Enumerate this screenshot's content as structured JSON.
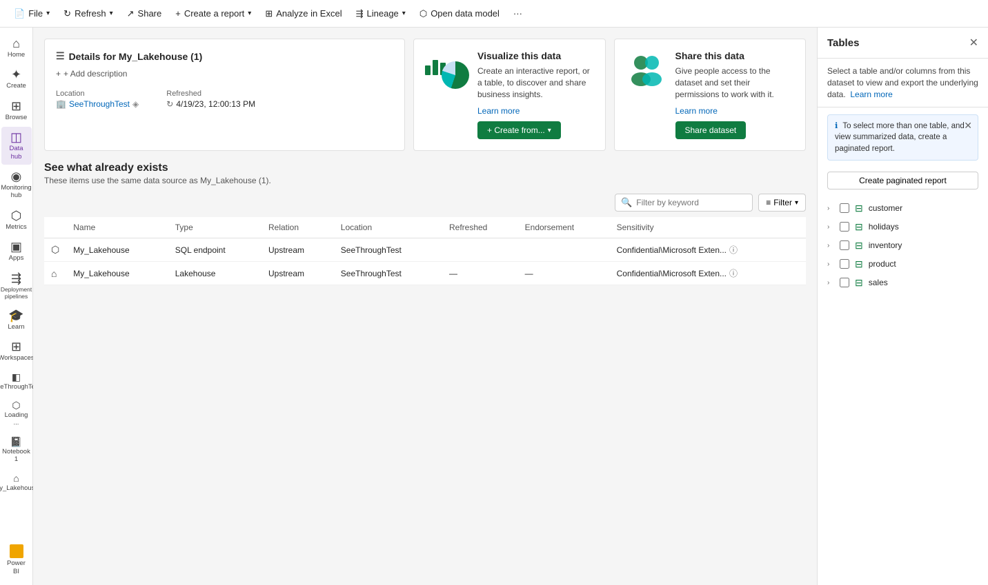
{
  "toolbar": {
    "file_label": "File",
    "refresh_label": "Refresh",
    "share_label": "Share",
    "create_report_label": "Create a report",
    "analyze_excel_label": "Analyze in Excel",
    "lineage_label": "Lineage",
    "open_data_model_label": "Open data model",
    "more_label": "···"
  },
  "sidebar": {
    "items": [
      {
        "id": "home",
        "label": "Home",
        "icon": "⌂"
      },
      {
        "id": "create",
        "label": "Create",
        "icon": "+"
      },
      {
        "id": "browse",
        "label": "Browse",
        "icon": "⊞"
      },
      {
        "id": "datahub",
        "label": "Data hub",
        "icon": "◫",
        "active": true
      },
      {
        "id": "monitoring",
        "label": "Monitoring hub",
        "icon": "◉"
      },
      {
        "id": "metrics",
        "label": "Metrics",
        "icon": "⬡"
      },
      {
        "id": "apps",
        "label": "Apps",
        "icon": "▣"
      },
      {
        "id": "deployment",
        "label": "Deployment pipelines",
        "icon": "⇶"
      },
      {
        "id": "learn",
        "label": "Learn",
        "icon": "📖"
      },
      {
        "id": "workspaces",
        "label": "Workspaces",
        "icon": "⊞"
      },
      {
        "id": "seethrough",
        "label": "SeeThroughTest",
        "icon": "◧"
      },
      {
        "id": "loading",
        "label": "Loading ...",
        "icon": "⬡"
      },
      {
        "id": "notebook",
        "label": "Notebook 1",
        "icon": "📓"
      },
      {
        "id": "mylakehouse",
        "label": "My_Lakehouse",
        "icon": "⌂"
      }
    ],
    "powerbi_label": "Power BI"
  },
  "details_card": {
    "title": "Details for My_Lakehouse (1)",
    "add_desc_label": "+ Add description",
    "location_label": "Location",
    "location_value": "SeeThroughTest",
    "refreshed_label": "Refreshed",
    "refreshed_value": "4/19/23, 12:00:13 PM"
  },
  "visualize_card": {
    "title": "Visualize this data",
    "description": "Create an interactive report, or a table, to discover and share business insights.",
    "learn_more": "Learn more",
    "create_btn": "+ Create from...",
    "create_dropdown": true
  },
  "share_card": {
    "title": "Share this data",
    "description": "Give people access to the dataset and set their permissions to work with it.",
    "learn_more": "Learn more",
    "share_btn": "Share dataset"
  },
  "section": {
    "title": "See what already exists",
    "subtitle": "These items use the same data source as My_Lakehouse (1).",
    "search_placeholder": "Filter by keyword",
    "filter_label": "Filter"
  },
  "table": {
    "columns": [
      "Name",
      "Type",
      "Relation",
      "Location",
      "Refreshed",
      "Endorsement",
      "Sensitivity"
    ],
    "rows": [
      {
        "icon": "sql",
        "name": "My_Lakehouse",
        "type": "SQL endpoint",
        "relation": "Upstream",
        "location": "SeeThroughTest",
        "refreshed": "",
        "endorsement": "",
        "sensitivity": "Confidential\\Microsoft Exten...",
        "has_info": true
      },
      {
        "icon": "lakehouse",
        "name": "My_Lakehouse",
        "type": "Lakehouse",
        "relation": "Upstream",
        "location": "SeeThroughTest",
        "refreshed": "—",
        "endorsement": "—",
        "sensitivity": "Confidential\\Microsoft Exten...",
        "has_info": true
      }
    ]
  },
  "right_panel": {
    "title": "Tables",
    "description": "Select a table and/or columns from this dataset to view and export the underlying data.",
    "learn_more": "Learn more",
    "info_text": "To select more than one table, and view summarized data, create a paginated report.",
    "create_paginated_btn": "Create paginated report",
    "tables": [
      {
        "name": "customer"
      },
      {
        "name": "holidays"
      },
      {
        "name": "inventory"
      },
      {
        "name": "product"
      },
      {
        "name": "sales"
      }
    ]
  }
}
